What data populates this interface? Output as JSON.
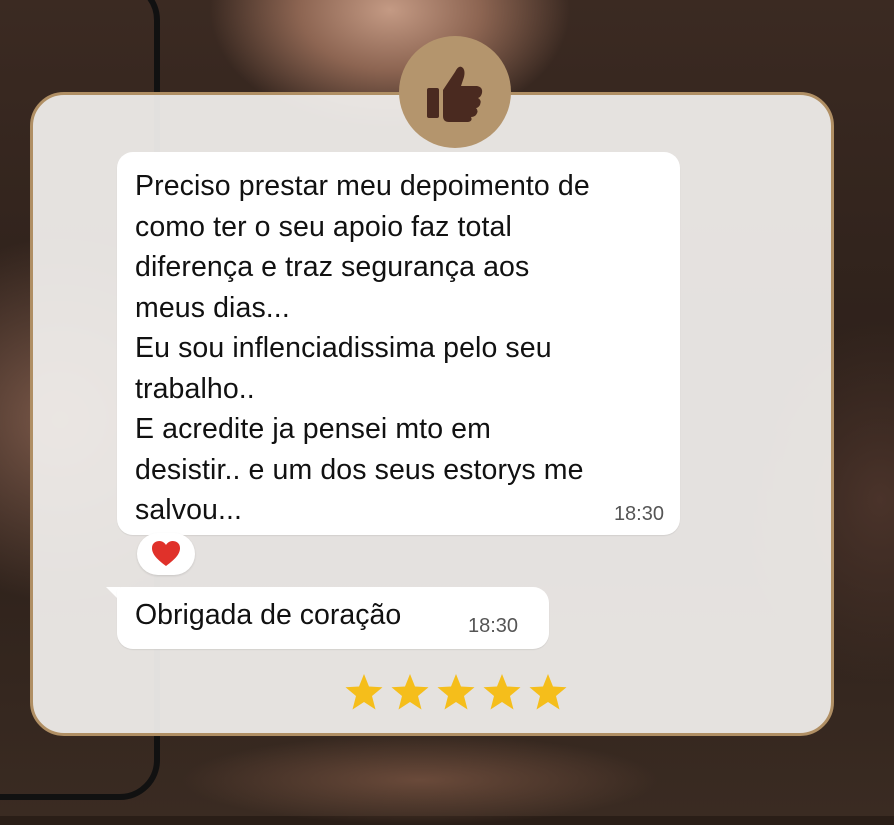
{
  "message": {
    "text": "Preciso prestar meu depoimento de\ncomo ter o seu apoio faz total\ndiferença e traz segurança aos\nmeus dias...\nEu sou inflenciadissima pelo seu\ntrabalho..\nE acredite ja pensei mto em\ndesistir.. e um dos seus estorys me\nsalvou...",
    "time": "18:30",
    "reaction": "heart"
  },
  "reply": {
    "text": "Obrigada de coração",
    "time": "18:30"
  },
  "rating": {
    "stars": 5,
    "max": 5
  },
  "badge": {
    "icon": "thumbs-up-icon"
  },
  "colors": {
    "accent": "#b4956d",
    "card_border": "#b08f64",
    "icon": "#4a2a20",
    "star": "#f5be1b",
    "heart": "#e0312a"
  }
}
